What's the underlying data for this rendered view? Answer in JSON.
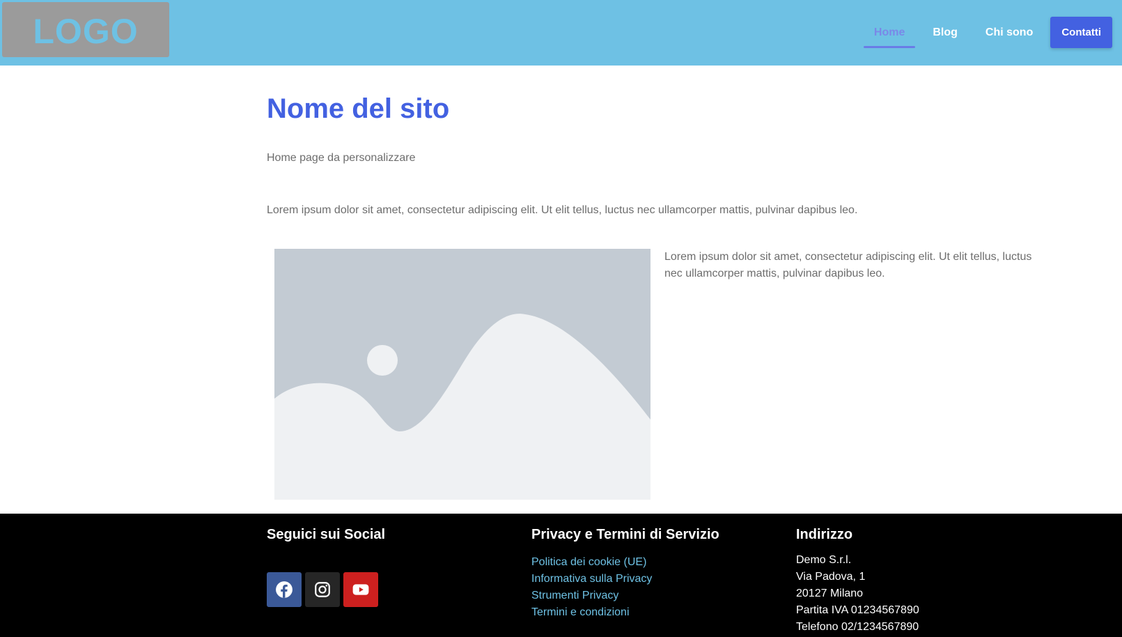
{
  "header": {
    "logo_text": "LOGO",
    "nav": [
      {
        "label": "Home",
        "active": true
      },
      {
        "label": "Blog",
        "active": false
      },
      {
        "label": "Chi sono",
        "active": false
      }
    ],
    "cta_label": "Contatti"
  },
  "main": {
    "title": "Nome del sito",
    "subtitle": "Home page da personalizzare",
    "intro": "Lorem ipsum dolor sit amet, consectetur adipiscing elit. Ut elit tellus, luctus nec ullamcorper mattis, pulvinar dapibus leo.",
    "image_icon": "image-placeholder-icon",
    "side_text": "Lorem ipsum dolor sit amet, consectetur adipiscing elit. Ut elit tellus, luctus nec ullamcorper mattis, pulvinar dapibus leo."
  },
  "footer": {
    "social": {
      "title": "Seguici sui Social",
      "icons": [
        {
          "name": "facebook-icon",
          "color": "#3b5998"
        },
        {
          "name": "instagram-icon",
          "color": "#262626"
        },
        {
          "name": "youtube-icon",
          "color": "#cd201f"
        }
      ]
    },
    "privacy": {
      "title": "Privacy e Termini di Servizio",
      "links": [
        "Politica dei cookie (UE)",
        "Informativa sulla Privacy",
        "Strumenti Privacy",
        "Termini e condizioni"
      ]
    },
    "address": {
      "title": "Indirizzo",
      "lines": [
        "Demo S.r.l.",
        "Via Padova, 1",
        "20127 Milano",
        "Partita IVA 01234567890",
        "Telefono 02/1234567890"
      ]
    }
  },
  "colors": {
    "header_bg": "#6ec1e4",
    "accent": "#4361e1",
    "logo_bg": "#9b9b9b",
    "footer_bg": "#000000",
    "link": "#6ec1e4"
  }
}
